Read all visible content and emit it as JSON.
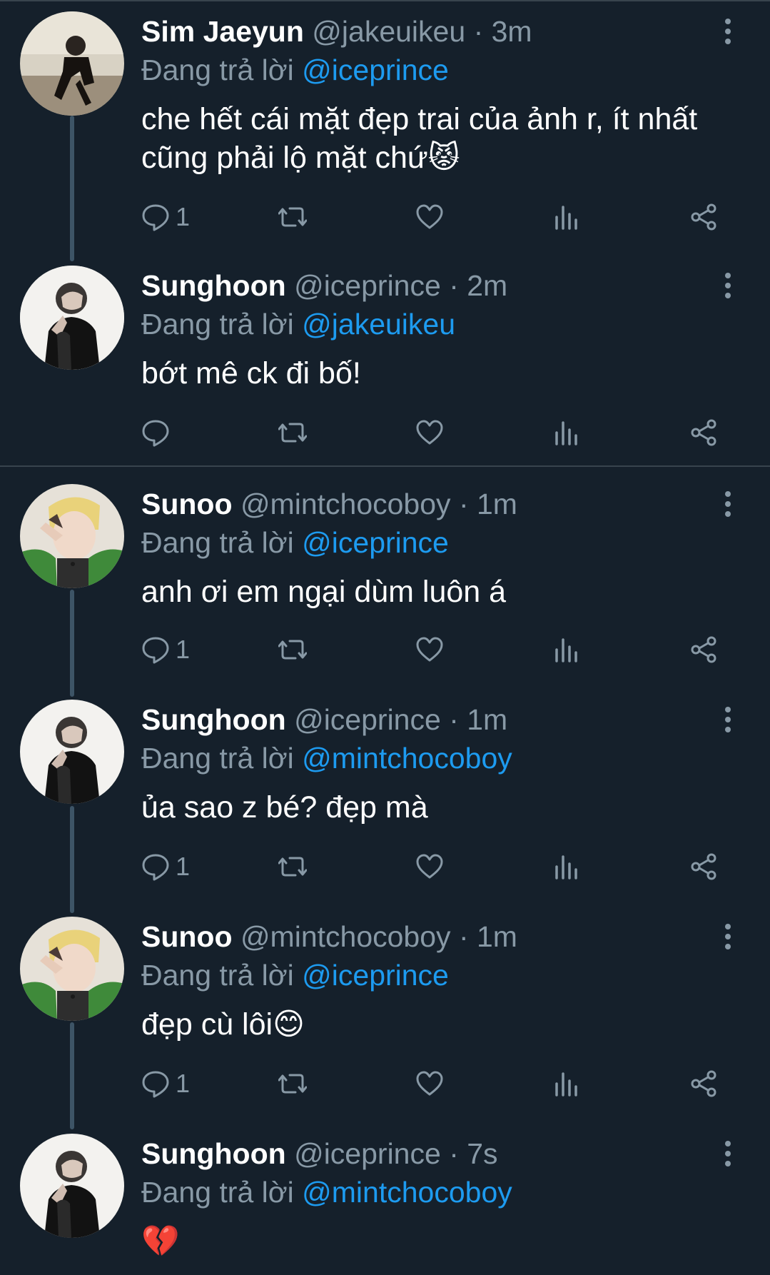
{
  "replying_label": "Đang trả lời",
  "tweets": [
    {
      "name": "Sim Jaeyun",
      "handle": "@jakeuikeu",
      "dot": "·",
      "time": "3m",
      "replying_to": "@iceprince",
      "text": "che hết cái mặt đẹp trai của ảnh r, ít nhất cũng phải lộ mặt chứ😾",
      "reply_count": "1"
    },
    {
      "name": "Sunghoon",
      "handle": "@iceprince",
      "dot": "·",
      "time": "2m",
      "replying_to": "@jakeuikeu",
      "text": "bớt mê ck đi bố!",
      "reply_count": ""
    },
    {
      "name": "Sunoo",
      "handle": "@mintchocoboy",
      "dot": "·",
      "time": "1m",
      "replying_to": "@iceprince",
      "text": "anh ơi em ngại dùm luôn á",
      "reply_count": "1"
    },
    {
      "name": "Sunghoon",
      "handle": "@iceprince",
      "dot": "·",
      "time": "1m",
      "replying_to": "@mintchocoboy",
      "text": "ủa sao z bé? đẹp mà",
      "reply_count": "1"
    },
    {
      "name": "Sunoo",
      "handle": "@mintchocoboy",
      "dot": "·",
      "time": "1m",
      "replying_to": "@iceprince",
      "text": "đẹp cù lôi😊",
      "reply_count": "1"
    },
    {
      "name": "Sunghoon",
      "handle": "@iceprince",
      "dot": "·",
      "time": "7s",
      "replying_to": "@mintchocoboy",
      "text": "💔",
      "reply_count": ""
    }
  ],
  "colors": {
    "background": "#15202b",
    "secondary_text": "#8899a6",
    "mention": "#1d9bf0",
    "thread_line": "#3d5466",
    "divider": "#38444d"
  },
  "icons": [
    "reply-icon",
    "retweet-icon",
    "like-icon",
    "analytics-icon",
    "share-icon",
    "more-options-icon"
  ]
}
